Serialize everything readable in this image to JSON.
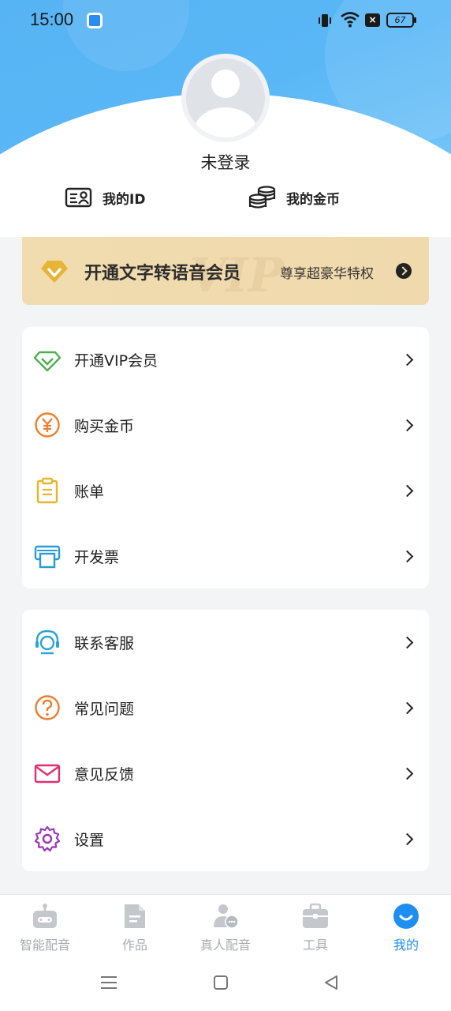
{
  "status_bar": {
    "time": "15:00",
    "battery": "67"
  },
  "profile": {
    "login_text": "未登录"
  },
  "quick_links": {
    "my_id": "我的ID",
    "my_coins": "我的金币"
  },
  "vip_banner": {
    "title": "开通文字转语音会员",
    "subtitle": "尊享超豪华特权",
    "watermark": "VIP",
    "colors": {
      "background": "#f0dbae",
      "gem": "#e7b435"
    }
  },
  "menu_group_1": [
    {
      "label": "开通VIP会员",
      "icon": "vip-diamond-icon",
      "color": "#4caf50"
    },
    {
      "label": "购买金币",
      "icon": "yen-coin-icon",
      "color": "#ef7d2d"
    },
    {
      "label": "账单",
      "icon": "clipboard-icon",
      "color": "#e8b52a"
    },
    {
      "label": "开发票",
      "icon": "printer-icon",
      "color": "#2b9ad6"
    }
  ],
  "menu_group_2": [
    {
      "label": "联系客服",
      "icon": "headset-icon",
      "color": "#29a3d8"
    },
    {
      "label": "常见问题",
      "icon": "question-icon",
      "color": "#ef7d2d"
    },
    {
      "label": "意见反馈",
      "icon": "envelope-icon",
      "color": "#e0306a"
    },
    {
      "label": "设置",
      "icon": "gear-icon",
      "color": "#9a35b8"
    }
  ],
  "bottom_nav": {
    "tabs": [
      {
        "label": "智能配音",
        "icon": "robot-icon"
      },
      {
        "label": "作品",
        "icon": "document-icon"
      },
      {
        "label": "真人配音",
        "icon": "person-voice-icon"
      },
      {
        "label": "工具",
        "icon": "toolbox-icon"
      },
      {
        "label": "我的",
        "icon": "smile-icon",
        "active": true
      }
    ],
    "active_color": "#1e8ff1",
    "inactive_color": "#c4c8cd"
  }
}
